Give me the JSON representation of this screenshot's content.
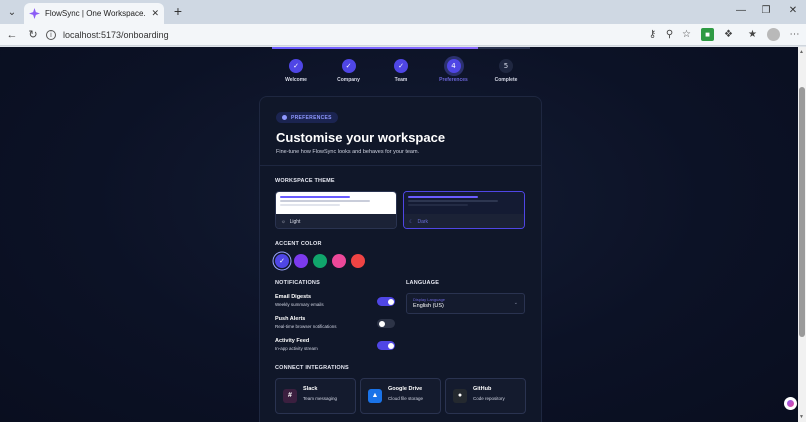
{
  "browser": {
    "tab_title": "FlowSync | One Workspace. Every",
    "url": "localhost:5173/onboarding"
  },
  "stepper": {
    "progress": 0.8,
    "steps": [
      {
        "label": "Welcome",
        "number": "1",
        "state": "done"
      },
      {
        "label": "Company",
        "number": "2",
        "state": "done"
      },
      {
        "label": "Team",
        "number": "3",
        "state": "done"
      },
      {
        "label": "Preferences",
        "number": "4",
        "state": "current"
      },
      {
        "label": "Complete",
        "number": "5",
        "state": "pending"
      }
    ]
  },
  "card": {
    "pill": "PREFERENCES",
    "title": "Customise your workspace",
    "subtitle": "Fine-tune how FlowSync looks and behaves for your team."
  },
  "theme": {
    "label": "WORKSPACE THEME",
    "options": [
      {
        "label": "Light",
        "selected": false
      },
      {
        "label": "Dark",
        "selected": true
      }
    ]
  },
  "accent": {
    "label": "ACCENT COLOR",
    "colors": [
      "#4f46e5",
      "#7c3aed",
      "#10a56b",
      "#ec4899",
      "#ef4444"
    ],
    "selected_index": 0
  },
  "notifications": {
    "label": "NOTIFICATIONS",
    "items": [
      {
        "title": "Email Digests",
        "desc": "Weekly summary emails",
        "on": true
      },
      {
        "title": "Push Alerts",
        "desc": "Real-time browser notifications",
        "on": false
      },
      {
        "title": "Activity Feed",
        "desc": "In-app activity stream",
        "on": true
      }
    ]
  },
  "language": {
    "label": "LANGUAGE",
    "hint": "Display Language",
    "value": "English (US)"
  },
  "integrations": {
    "label": "CONNECT INTEGRATIONS",
    "items": [
      {
        "name": "Slack",
        "desc": "Team messaging",
        "icon": "slack-icon",
        "color": "#3b1f3f"
      },
      {
        "name": "Google Drive",
        "desc": "Cloud file storage",
        "icon": "google-drive-icon",
        "color": "#1a73e8"
      },
      {
        "name": "GitHub",
        "desc": "Code repository",
        "icon": "github-icon",
        "color": "#24292f"
      }
    ]
  }
}
